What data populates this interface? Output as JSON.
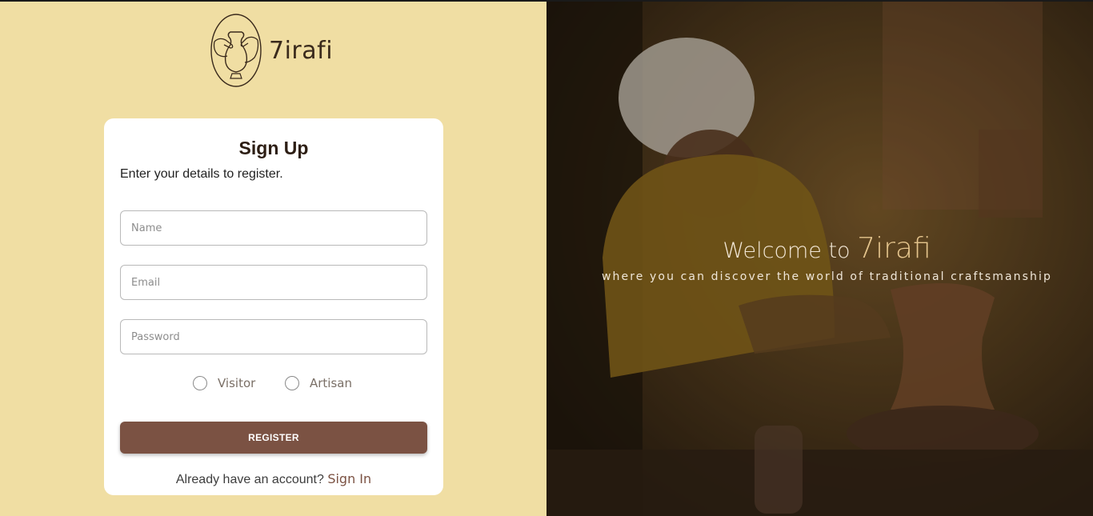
{
  "brand": {
    "name": "7irafi"
  },
  "form": {
    "title": "Sign Up",
    "subtitle": "Enter your details to register.",
    "name_placeholder": "Name",
    "email_placeholder": "Email",
    "password_placeholder": "Password",
    "roles": [
      "Visitor",
      "Artisan"
    ],
    "register_label": "REGISTER",
    "signin_prompt": "Already have an account?",
    "signin_link": "Sign In"
  },
  "hero": {
    "welcome_text": "Welcome to",
    "brand_text": "7irafi",
    "tagline": "where you can discover the world of traditional craftsmanship"
  },
  "colors": {
    "left_bg": "#f0dea3",
    "button": "#7b5243",
    "accent": "#e5c58d"
  }
}
